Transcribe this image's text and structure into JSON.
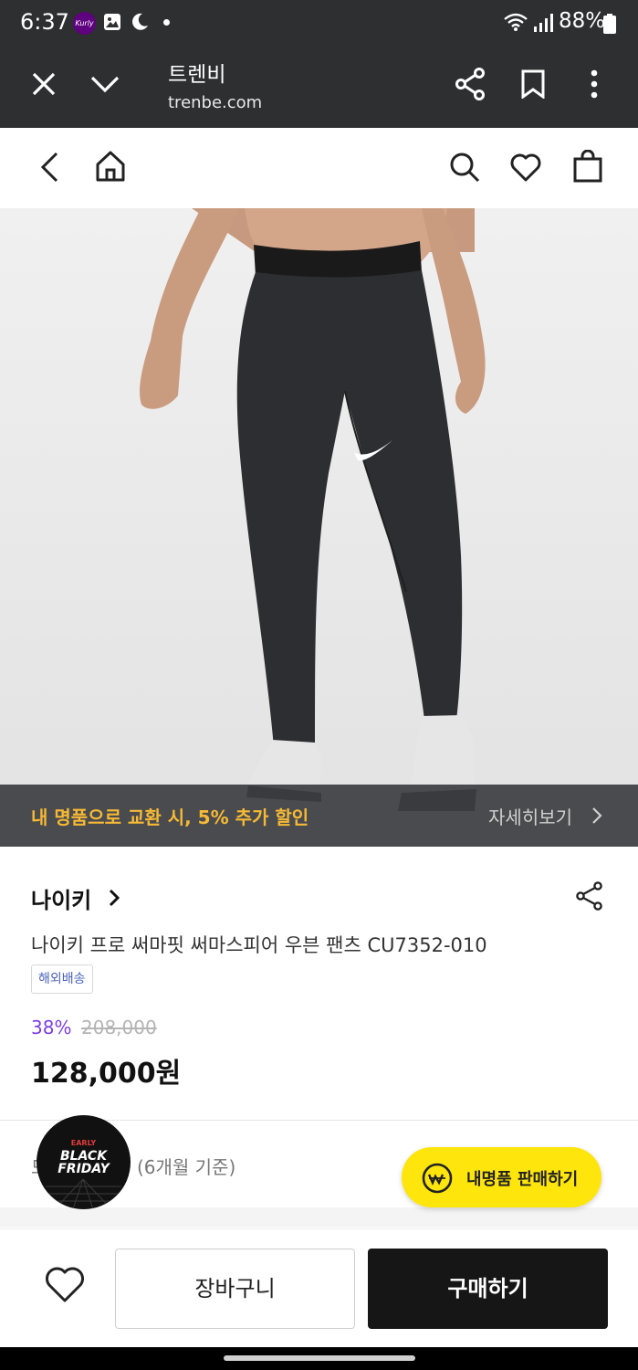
{
  "status_bar": {
    "time": "6:37",
    "kurly_badge": "Kurly",
    "battery": "88%",
    "icons": [
      "kurly-app-icon",
      "gallery-icon",
      "moon-icon",
      "dot-icon",
      "wifi-icon",
      "signal-icon",
      "battery-icon"
    ]
  },
  "browser_bar": {
    "title": "트렌비",
    "url": "trenbe.com",
    "icons": [
      "close-icon",
      "chevron-down-icon",
      "share-icon",
      "bookmark-icon",
      "more-vert-icon"
    ]
  },
  "app_header": {
    "icons": [
      "back-icon",
      "home-icon",
      "search-icon",
      "heart-icon",
      "shopping-bag-icon"
    ]
  },
  "hero": {
    "image": "product-photo-black-training-pants",
    "banner_text": "내 명품으로 교환 시, 5% 추가 할인",
    "banner_link": "자세히보기"
  },
  "product": {
    "brand": "나이키",
    "name": "나이키 프로 써마핏 써마스피어 우븐 팬츠 CU7352-010",
    "shipping_tag": "해외배송",
    "discount_rate": "38%",
    "original_price": "208,000",
    "price": "128,000원"
  },
  "history": {
    "lead": "모",
    "period": "(6개월 기준)"
  },
  "badge": {
    "early": "EARLY",
    "line1": "BLACK",
    "line2": "FRIDAY"
  },
  "sell_button": {
    "label": "내명품 판매하기"
  },
  "bottom_bar": {
    "cart_label": "장바구니",
    "buy_label": "구매하기"
  },
  "colors": {
    "browser_bg": "#2d2f31",
    "promo_text": "#f6b935",
    "discount": "#7b3fe4",
    "sell_button": "#fee50c",
    "buy_button": "#161616"
  }
}
